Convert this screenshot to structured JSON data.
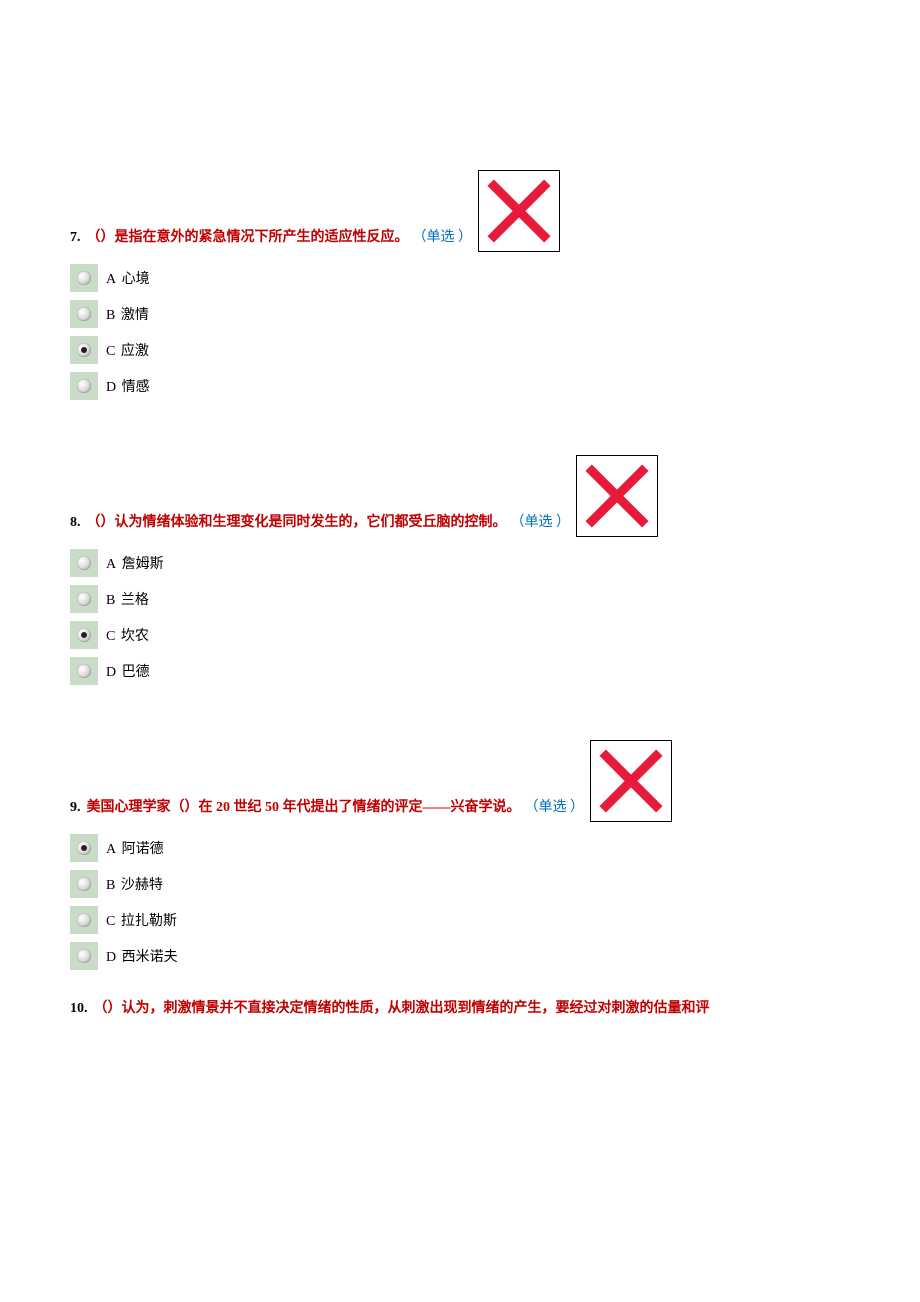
{
  "questions": [
    {
      "number": "7.",
      "text": "（）是指在意外的紧急情况下所产生的适应性反应。",
      "type_label": "（单选 ）",
      "result": "wrong",
      "options": [
        {
          "letter": "A",
          "label": "心境",
          "checked": false
        },
        {
          "letter": "B",
          "label": "激情",
          "checked": false
        },
        {
          "letter": "C",
          "label": "应激",
          "checked": true
        },
        {
          "letter": "D",
          "label": "情感",
          "checked": false
        }
      ]
    },
    {
      "number": "8.",
      "text": "（）认为情绪体验和生理变化是同时发生的，它们都受丘脑的控制。",
      "type_label": "（单选 ）",
      "result": "wrong",
      "options": [
        {
          "letter": "A",
          "label": "詹姆斯",
          "checked": false
        },
        {
          "letter": "B",
          "label": "兰格",
          "checked": false
        },
        {
          "letter": "C",
          "label": "坎农",
          "checked": true
        },
        {
          "letter": "D",
          "label": "巴德",
          "checked": false
        }
      ]
    },
    {
      "number": "9.",
      "text": "美国心理学家（）在 20 世纪 50 年代提出了情绪的评定——兴奋学说。",
      "type_label": "（单选 ）",
      "result": "wrong",
      "options": [
        {
          "letter": "A",
          "label": "阿诺德",
          "checked": true
        },
        {
          "letter": "B",
          "label": "沙赫特",
          "checked": false
        },
        {
          "letter": "C",
          "label": "拉扎勒斯",
          "checked": false
        },
        {
          "letter": "D",
          "label": "西米诺夫",
          "checked": false
        }
      ]
    },
    {
      "number": "10.",
      "text": "（）认为，刺激情景并不直接决定情绪的性质，从刺激出现到情绪的产生，要经过对刺激的估量和评",
      "type_label": "",
      "result": "",
      "options": []
    }
  ]
}
